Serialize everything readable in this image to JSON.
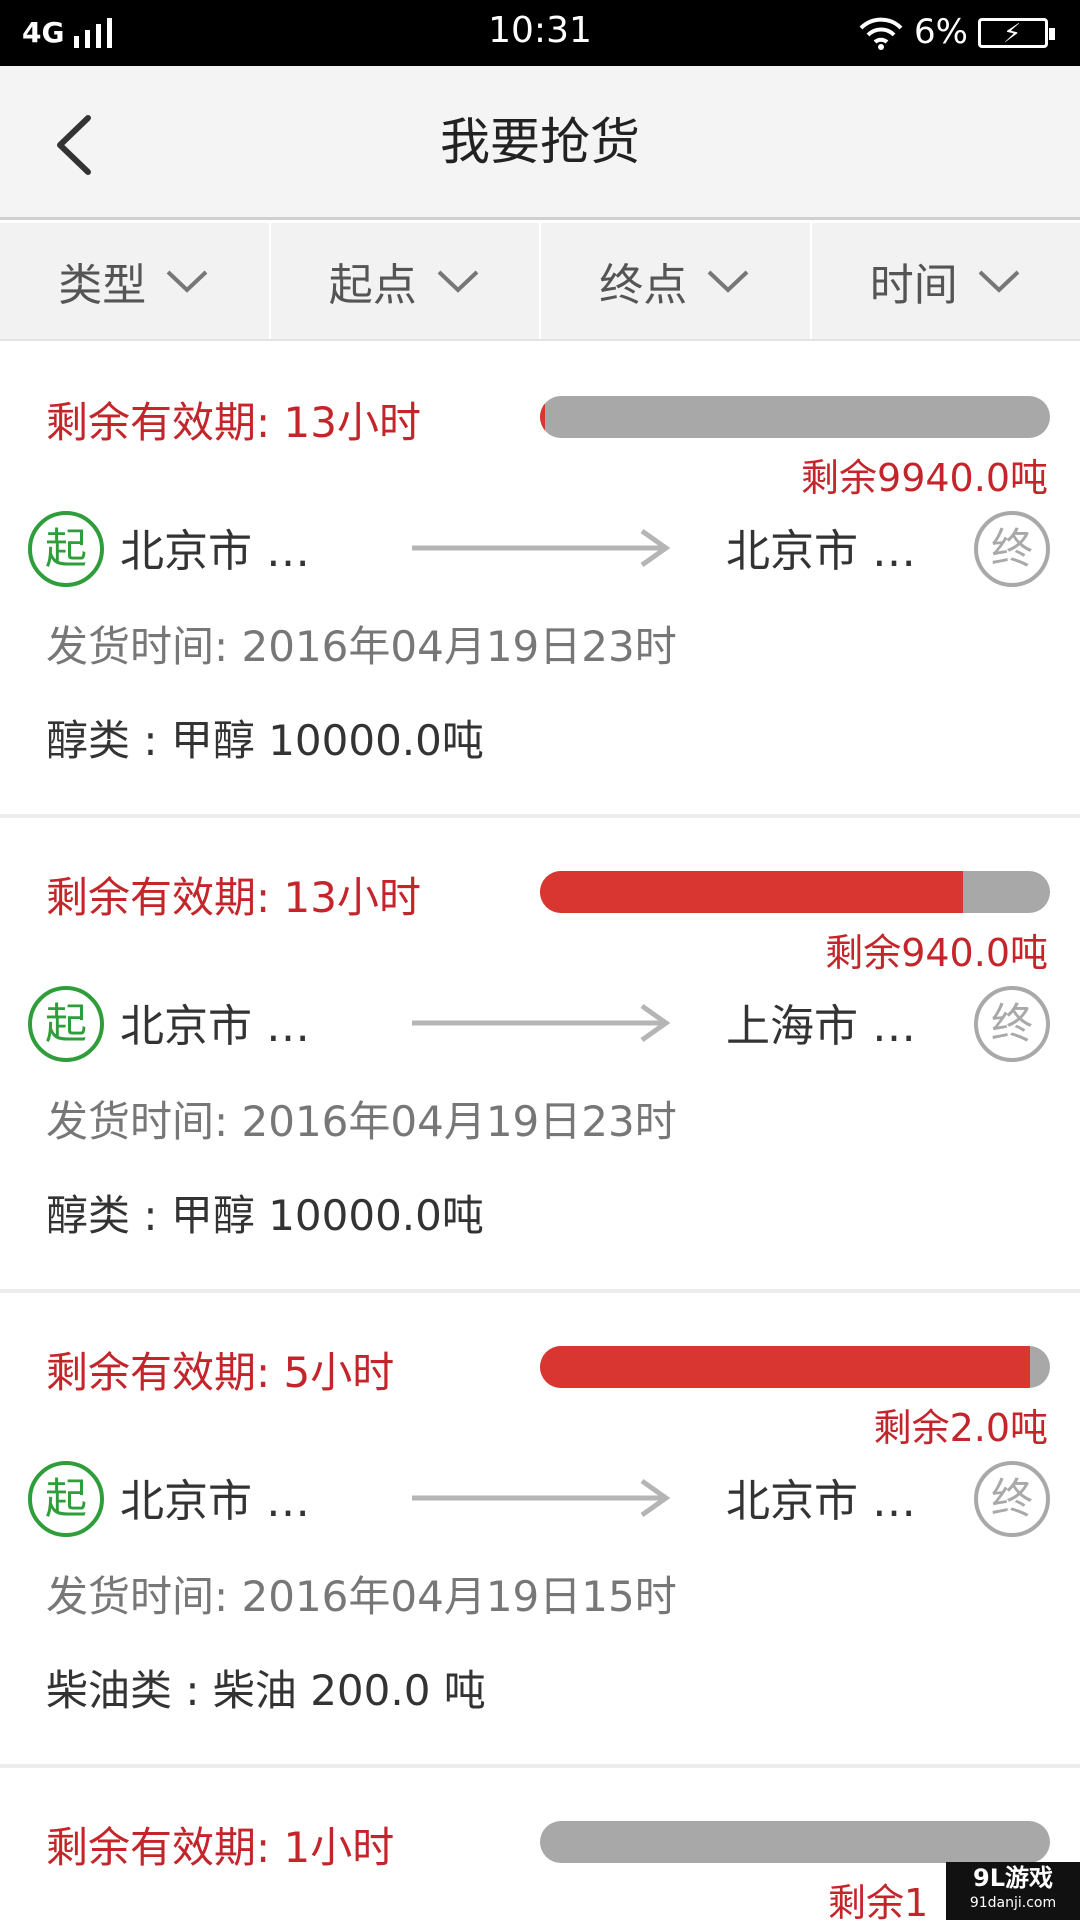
{
  "status_bar": {
    "network": "4G",
    "time": "10:31",
    "battery_percent": "6%"
  },
  "header": {
    "title": "我要抢货"
  },
  "filters": [
    {
      "label": "类型"
    },
    {
      "label": "起点"
    },
    {
      "label": "终点"
    },
    {
      "label": "时间"
    }
  ],
  "cards": [
    {
      "validity": "剩余有效期: 13小时",
      "progress": 0.01,
      "remaining": "剩余9940.0吨",
      "start_badge": "起",
      "origin": "北京市 …",
      "destination": "北京市 …",
      "end_badge": "终",
      "ship_time": "发货时间: 2016年04月19日23时",
      "cargo": "醇类 : 甲醇  10000.0吨"
    },
    {
      "validity": "剩余有效期: 13小时",
      "progress": 0.83,
      "remaining": "剩余940.0吨",
      "start_badge": "起",
      "origin": "北京市 …",
      "destination": "上海市 …",
      "end_badge": "终",
      "ship_time": "发货时间: 2016年04月19日23时",
      "cargo": "醇类 : 甲醇  10000.0吨"
    },
    {
      "validity": "剩余有效期: 5小时",
      "progress": 0.96,
      "remaining": "剩余2.0吨",
      "start_badge": "起",
      "origin": "北京市 …",
      "destination": "北京市 …",
      "end_badge": "终",
      "ship_time": "发货时间: 2016年04月19日15时",
      "cargo": "柴油类 : 柴油 200.0 吨"
    },
    {
      "validity": "剩余有效期: 1小时",
      "progress": 0,
      "remaining": "剩余1"
    }
  ],
  "watermark": {
    "main": "9L游戏",
    "sub": "91danji.com"
  },
  "colors": {
    "accent_red": "#c4252a",
    "bar_fill": "#d93531",
    "bar_track": "#a8a8a8",
    "start_green": "#2f9e3a",
    "end_gray": "#a9a9a9"
  }
}
